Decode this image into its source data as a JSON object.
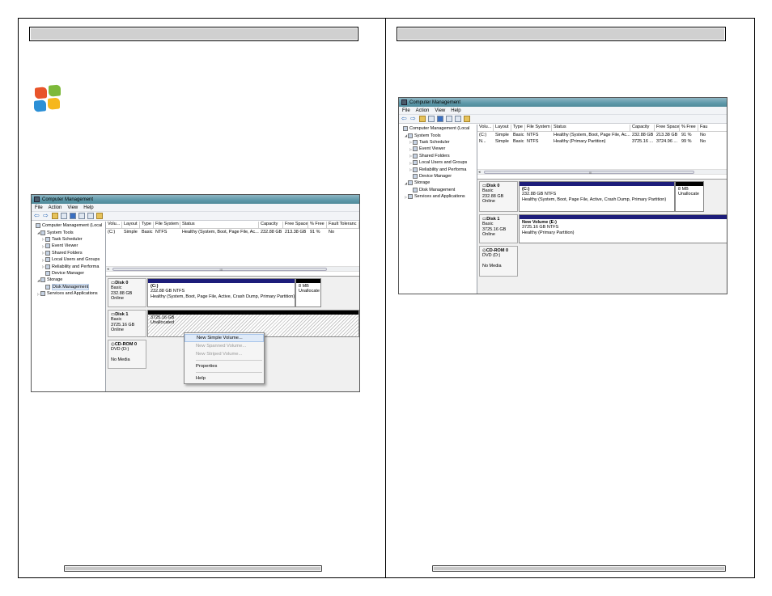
{
  "left_page": {
    "screenshot": {
      "title": "Computer Management",
      "menu": [
        "File",
        "Action",
        "View",
        "Help"
      ],
      "tree": [
        {
          "label": "Computer Management (Local",
          "level": 0,
          "tri": ""
        },
        {
          "label": "System Tools",
          "level": 1,
          "tri": "◢"
        },
        {
          "label": "Task Scheduler",
          "level": 2,
          "tri": "▷"
        },
        {
          "label": "Event Viewer",
          "level": 2,
          "tri": "▷"
        },
        {
          "label": "Shared Folders",
          "level": 2,
          "tri": "▷"
        },
        {
          "label": "Local Users and Groups",
          "level": 2,
          "tri": "▷"
        },
        {
          "label": "Reliability and Performa",
          "level": 2,
          "tri": "▷"
        },
        {
          "label": "Device Manager",
          "level": 2,
          "tri": ""
        },
        {
          "label": "Storage",
          "level": 1,
          "tri": "◢"
        },
        {
          "label": "Disk Management",
          "level": 2,
          "tri": "",
          "selected": true
        },
        {
          "label": "Services and Applications",
          "level": 1,
          "tri": "▷"
        }
      ],
      "columns": [
        "Volu...",
        "Layout",
        "Type",
        "File System",
        "Status",
        "Capacity",
        "Free Space",
        "% Free",
        "Fault Toleranc"
      ],
      "rows": [
        [
          "(C:)",
          "Simple",
          "Basic",
          "NTFS",
          "Healthy (System, Boot, Page File, Ac...",
          "232.88 GB",
          "213.38 GB",
          "91 %",
          "No"
        ]
      ],
      "scroll_grip": "III",
      "disks": [
        {
          "name": "Disk 0",
          "type": "Basic",
          "size": "232.88 GB",
          "state": "Online",
          "partitions": [
            {
              "title": "(C:)",
              "line1": "232.88 GB NTFS",
              "line2": "Healthy (System, Boot, Page File, Active, Crash Dump, Primary Partition)"
            },
            {
              "title": "",
              "line1": "8 MB",
              "line2": "Unallocate"
            }
          ]
        },
        {
          "name": "Disk 1",
          "type": "Basic",
          "size": "3725.16 GB",
          "state": "Online",
          "partitions": [
            {
              "title": "",
              "line1": "3725.16 GB",
              "line2": "Unallocated"
            }
          ]
        },
        {
          "name": "CD-ROM 0",
          "type": "DVD (D:)",
          "size": "",
          "state": "No Media",
          "partitions": []
        }
      ],
      "context_menu": {
        "items": [
          {
            "label": "New Simple Volume...",
            "state": "highlighted"
          },
          {
            "label": "New Spanned Volume...",
            "state": "disabled"
          },
          {
            "label": "New Striped Volume...",
            "state": "disabled"
          },
          {
            "label": "Properties",
            "state": "normal"
          },
          {
            "label": "Help",
            "state": "normal"
          }
        ]
      }
    }
  },
  "right_page": {
    "screenshot": {
      "title": "Computer Management",
      "menu": [
        "File",
        "Action",
        "View",
        "Help"
      ],
      "tree": [
        {
          "label": "Computer Management (Local",
          "level": 0,
          "tri": ""
        },
        {
          "label": "System Tools",
          "level": 1,
          "tri": "◢"
        },
        {
          "label": "Task Scheduler",
          "level": 2,
          "tri": "▷"
        },
        {
          "label": "Event Viewer",
          "level": 2,
          "tri": "▷"
        },
        {
          "label": "Shared Folders",
          "level": 2,
          "tri": "▷"
        },
        {
          "label": "Local Users and Groups",
          "level": 2,
          "tri": "▷"
        },
        {
          "label": "Reliability and Performa",
          "level": 2,
          "tri": "▷"
        },
        {
          "label": "Device Manager",
          "level": 2,
          "tri": ""
        },
        {
          "label": "Storage",
          "level": 1,
          "tri": "◢"
        },
        {
          "label": "Disk Management",
          "level": 2,
          "tri": ""
        },
        {
          "label": "Services and Applications",
          "level": 1,
          "tri": "▷"
        }
      ],
      "columns": [
        "Volu...",
        "Layout",
        "Type",
        "File System",
        "Status",
        "Capacity",
        "Free Space",
        "% Free",
        "Fau"
      ],
      "rows": [
        [
          "(C:)",
          "Simple",
          "Basic",
          "NTFS",
          "Healthy (System, Boot, Page File, Ac...",
          "232.88 GB",
          "213.38 GB",
          "91 %",
          "No"
        ],
        [
          "N...",
          "Simple",
          "Basic",
          "NTFS",
          "Healthy (Primary Partition)",
          "3725.16 ...",
          "3724.96 ...",
          "99 %",
          "No"
        ]
      ],
      "scroll_grip": "III",
      "disks": [
        {
          "name": "Disk 0",
          "type": "Basic",
          "size": "232.88 GB",
          "state": "Online",
          "partitions": [
            {
              "title": "(C:)",
              "line1": "232.88 GB NTFS",
              "line2": "Healthy (System, Boot, Page File, Active, Crash Dump, Primary Partition)"
            },
            {
              "title": "",
              "line1": "8 MB",
              "line2": "Unallocate"
            }
          ]
        },
        {
          "name": "Disk 1",
          "type": "Basic",
          "size": "3725.16 GB",
          "state": "Online",
          "partitions": [
            {
              "title": "New Volume (E:)",
              "line1": "3725.16 GB NTFS",
              "line2": "Healthy (Primary Partition)"
            }
          ]
        },
        {
          "name": "CD-ROM 0",
          "type": "DVD (D:)",
          "size": "",
          "state": "No Media",
          "partitions": []
        }
      ]
    }
  },
  "colors": {
    "header_bar": "#d0d0d0",
    "partition_primary": "#1d1d7a",
    "partition_unallocated": "#000000",
    "titlebar": "#5d98a9"
  },
  "icons": [
    "windows-logo-icon",
    "back-arrow-icon",
    "forward-arrow-icon",
    "disk-icon",
    "cdrom-icon"
  ]
}
